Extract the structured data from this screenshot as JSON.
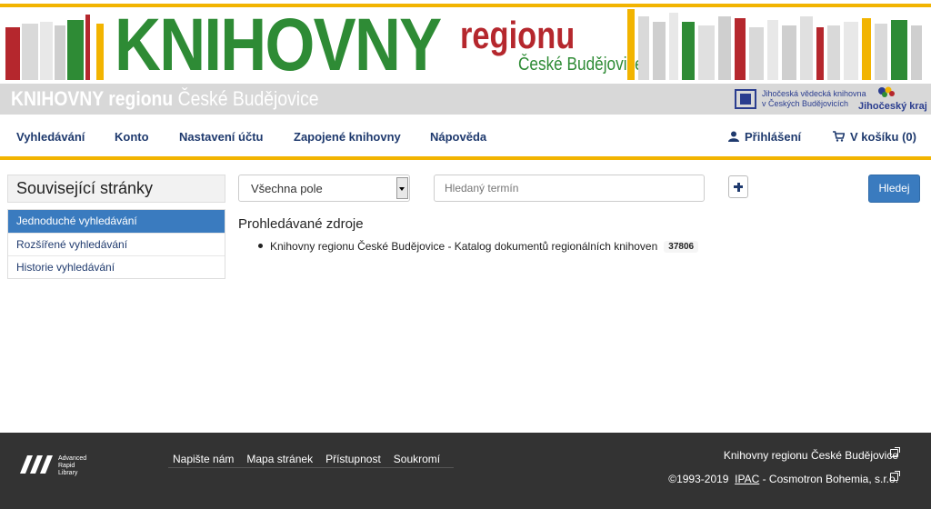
{
  "banner": {
    "title": "KNIHOVNY",
    "regionu": "regionu",
    "city": "České Budějovice"
  },
  "strip": {
    "title_bold": "KNIHOVNY regionu",
    "title_rest": " České Budějovice",
    "jvk_line1": "Jihočeská vědecká knihovna",
    "jvk_line2": "v Českých Budějovicích",
    "kraj": "Jihočeský kraj"
  },
  "nav": {
    "items": [
      "Vyhledávání",
      "Konto",
      "Nastavení účtu",
      "Zapojené knihovny",
      "Nápověda"
    ],
    "login": "Přihlášení",
    "cart": "V košíku (0)"
  },
  "sidebar": {
    "title": "Související stránky",
    "items": [
      "Jednoduché vyhledávání",
      "Rozšířené vyhledávání",
      "Historie vyhledávání"
    ]
  },
  "search": {
    "field_select": "Všechna pole",
    "term_placeholder": "Hledaný termín",
    "button": "Hledej"
  },
  "sources": {
    "title": "Prohledávané zdroje",
    "items": [
      {
        "label": "Knihovny regionu České Budějovice - Katalog dokumentů regionálních knihoven",
        "count": "37806"
      }
    ]
  },
  "footer": {
    "arl_line1": "Advanced",
    "arl_line2": "Rapid",
    "arl_line3": "Library",
    "links": [
      "Napište nám",
      "Mapa stránek",
      "Přístupnost",
      "Soukromí"
    ],
    "right_title": "Knihovny regionu České Budějovice",
    "copyright": "©1993-2019",
    "ipac": "IPAC",
    "company": " -  Cosmotron Bohemia, s.r.o."
  },
  "colors": {
    "accent_yellow": "#f2b400",
    "brand_green": "#2e8b35",
    "brand_red": "#b5272d",
    "nav_blue": "#1f3a6e",
    "button_blue": "#3a7bbf",
    "footer_bg": "#333333"
  }
}
